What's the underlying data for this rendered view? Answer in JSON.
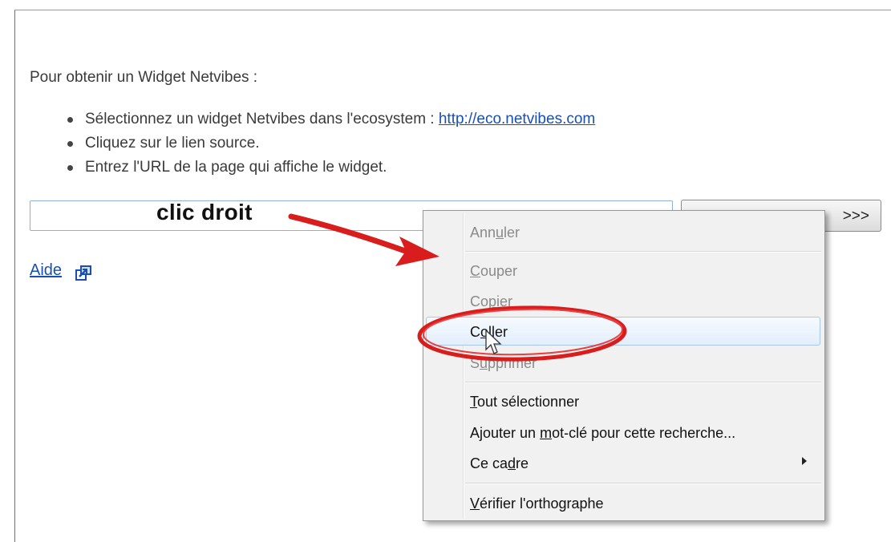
{
  "content": {
    "intro": "Pour obtenir un Widget Netvibes :",
    "steps": [
      {
        "before": "Sélectionnez un widget Netvibes dans l'ecosystem : ",
        "link": "http://eco.netvibes.com"
      },
      {
        "text": "Cliquez sur le lien source."
      },
      {
        "text": "Entrez l'URL de la page qui affiche le widget."
      }
    ],
    "help_link": "Aide",
    "button_label": ">>>"
  },
  "annotation": {
    "label": "clic droit",
    "color": "#d91c1c"
  },
  "menu": {
    "undo": {
      "before": "Ann",
      "key": "u",
      "after": "ler"
    },
    "cut": {
      "before": "",
      "key": "C",
      "after": "ouper"
    },
    "copy": {
      "before": "Co",
      "key": "p",
      "after": "ier"
    },
    "paste": {
      "before": "C",
      "key": "o",
      "after": "ller"
    },
    "delete": {
      "before": "S",
      "key": "u",
      "after": "pprimer"
    },
    "select_all": {
      "before": "",
      "key": "T",
      "after": "out sélectionner"
    },
    "add_keyword": {
      "before": "Ajouter un ",
      "key": "m",
      "after": "ot-clé pour cette recherche..."
    },
    "frame": {
      "before": "Ce ca",
      "key": "d",
      "after": "re"
    },
    "spellcheck": {
      "before": "",
      "key": "V",
      "after": "érifier l'orthographe"
    }
  },
  "icons": {
    "external_link": "external-link-icon",
    "cursor": "mouse-pointer-icon",
    "submenu": "submenu-arrow-icon"
  }
}
